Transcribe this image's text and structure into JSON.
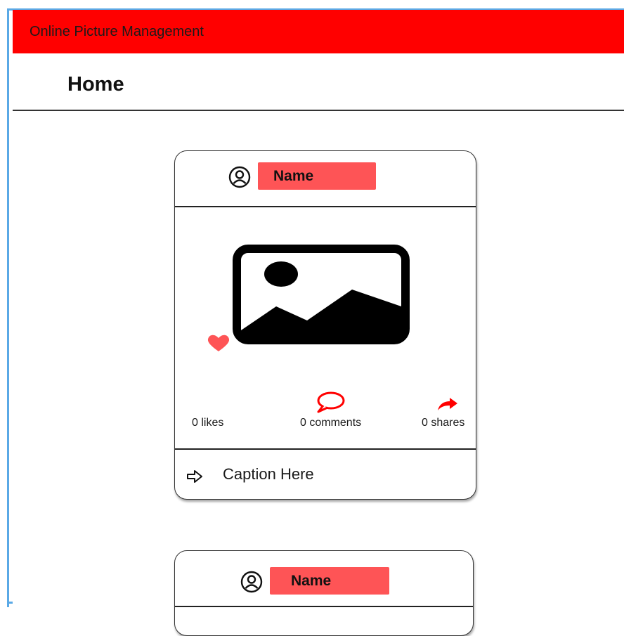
{
  "app": {
    "title": "Online Picture Management"
  },
  "page": {
    "title": "Home"
  },
  "posts": [
    {
      "author_name": "Name",
      "likes_label": "0 likes",
      "comments_label": "0 comments",
      "shares_label": "0 shares",
      "caption": "Caption Here"
    },
    {
      "author_name": "Name"
    }
  ],
  "colors": {
    "appbar": "#ff0000",
    "accent": "#fe5456",
    "frame": "#5aa9e6"
  },
  "icons": {
    "avatar": "user-circle-icon",
    "photo": "image-placeholder-icon",
    "like": "heart-icon",
    "comment": "comment-bubble-icon",
    "share": "share-arrow-icon",
    "caption": "arrow-right-outline-icon"
  }
}
